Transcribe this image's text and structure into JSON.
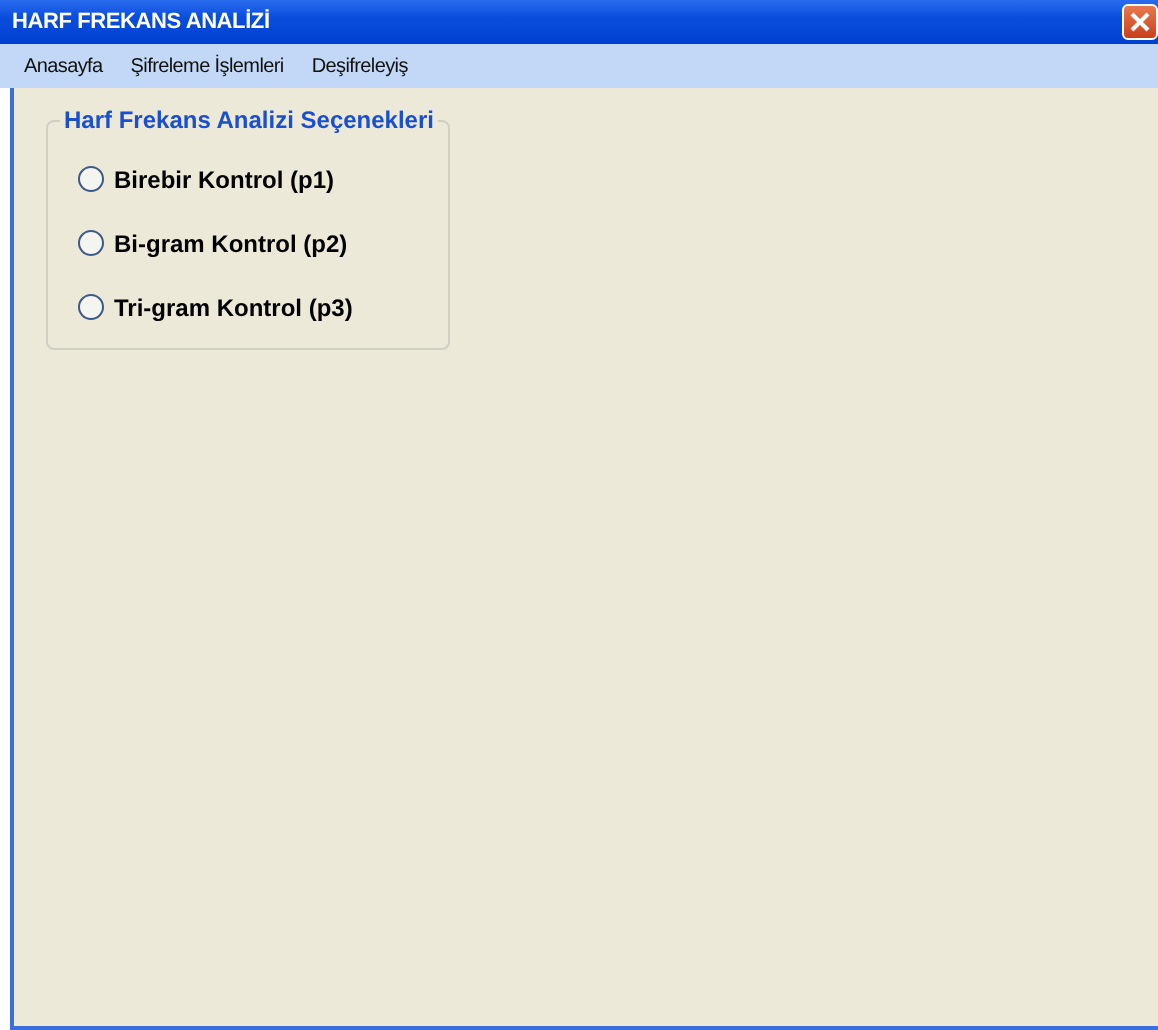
{
  "window": {
    "title": "HARF FREKANS ANALİZİ"
  },
  "menu": [
    {
      "label": "Anasayfa"
    },
    {
      "label": "Şifreleme İşlemleri"
    },
    {
      "label": "Deşifreleyiş"
    }
  ],
  "group": {
    "title": "Harf Frekans Analizi Seçenekleri",
    "options": [
      {
        "label": "Birebir Kontrol (p1)",
        "selected": false
      },
      {
        "label": "Bi-gram Kontrol (p2)",
        "selected": false
      },
      {
        "label": "Tri-gram Kontrol (p3)",
        "selected": false
      }
    ]
  }
}
